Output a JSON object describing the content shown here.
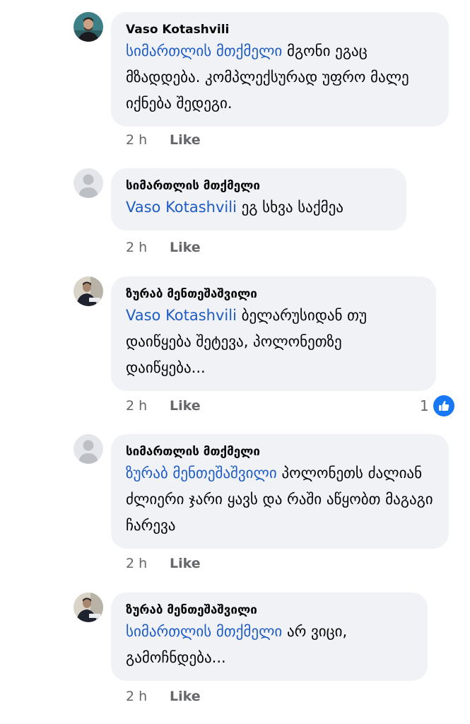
{
  "comments": [
    {
      "author": "Vaso Kotashvili",
      "mention": "სიმართლის მთქმელი",
      "text": " მგონი ეგაც მზადდება. კომპლექსურად უფრო მალე იქნება შედეგი.",
      "time": "2 h",
      "like_label": "Like"
    },
    {
      "author": "სიმართლის მთქმელი",
      "mention": "Vaso Kotashvili",
      "text": " ეგ სხვა საქმეა",
      "time": "2 h",
      "like_label": "Like"
    },
    {
      "author": "ზურაბ მენთეშაშვილი",
      "mention": "Vaso Kotashvili",
      "text": " ბელარუსიდან თუ დაიწყება შეტევა, პოლონეთზე დაიწყება...",
      "time": "2 h",
      "like_label": "Like",
      "reaction_count": "1"
    },
    {
      "author": "სიმართლის მთქმელი",
      "mention": "ზურაბ მენთეშაშვილი",
      "text": " პოლონეთს ძალიან ძლიერი ჯარი ყავს და რაში აწყობთ მაგაგი ჩარევა",
      "time": "2 h",
      "like_label": "Like"
    },
    {
      "author": "ზურაბ მენთეშაშვილი",
      "mention": "სიმართლის მთქმელი",
      "text": "  არ ვიცი, გამოჩნდება...",
      "time": "2 h",
      "like_label": "Like"
    }
  ],
  "colors": {
    "bubble": "#f0f2f5",
    "mention": "#1e5cc4",
    "meta": "#65676b",
    "like_reaction": "#1877f2"
  },
  "icons": {
    "reaction": "thumbs-up-icon",
    "default_avatar": "default-avatar-icon"
  }
}
